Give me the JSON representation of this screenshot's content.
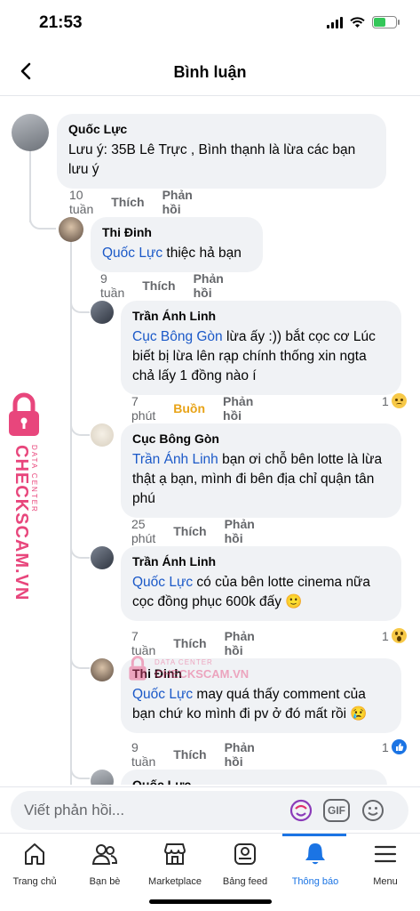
{
  "status_bar": {
    "time": "21:53"
  },
  "header": {
    "title": "Bình luận"
  },
  "comments": [
    {
      "author": "Quốc Lực",
      "mention": "",
      "text": "Lưu ý: 35B Lê Trực , Bình thạnh là lừa các bạn lưu ý",
      "time": "10 tuần",
      "like": "Thích",
      "reply": "Phản hồi"
    },
    {
      "author": "Thi Đinh",
      "mention": "Quốc Lực",
      "text": "thiệc hả bạn",
      "time": "9 tuần",
      "like": "Thích",
      "reply": "Phản hồi"
    },
    {
      "author": "Trần Ánh Linh",
      "mention": "Cục Bông Gòn",
      "text": "lừa ấy :)) bắt cọc cơ Lúc biết bị lừa lên rạp chính thống xin ngta chả lấy 1 đồng nào í",
      "time": "7 phút",
      "like": "Buồn",
      "reply": "Phản hồi",
      "reaction_count": "1",
      "reaction": "sad-emoji"
    },
    {
      "author": "Cục Bông Gòn",
      "mention": "Trần Ánh Linh",
      "text": "bạn ơi chỗ bên lotte là lừa thật ạ bạn, mình đi bên địa chỉ quận tân phú",
      "time": "25 phút",
      "like": "Thích",
      "reply": "Phản hồi"
    },
    {
      "author": "Trần Ánh Linh",
      "mention": "Quốc Lực",
      "text": "có của bên lotte cinema nữa cọc đồng phục 600k đấy 🙂",
      "time": "7 tuần",
      "like": "Thích",
      "reply": "Phản hồi",
      "reaction_count": "1",
      "reaction": "wow-emoji"
    },
    {
      "author": "Thi Đinh",
      "mention": "Quốc Lực",
      "text": "may quá thấy comment của bạn chứ ko mình đi pv ở đó mất rồi 😢",
      "time": "9 tuần",
      "like": "Thích",
      "reply": "Phản hồi",
      "reaction_count": "1",
      "reaction": "like-emoji"
    },
    {
      "author": "Quốc Lực",
      "mention": "",
      "text": "",
      "time": "",
      "like": "",
      "reply": ""
    }
  ],
  "composer": {
    "placeholder": "Viết phản hồi...",
    "gif_label": "GIF"
  },
  "tabs": [
    {
      "label": "Trang chủ",
      "icon": "home-icon"
    },
    {
      "label": "Bạn bè",
      "icon": "friends-icon"
    },
    {
      "label": "Marketplace",
      "icon": "marketplace-icon"
    },
    {
      "label": "Bảng feed",
      "icon": "feed-icon"
    },
    {
      "label": "Thông báo",
      "icon": "bell-icon",
      "active": true
    },
    {
      "label": "Menu",
      "icon": "menu-icon"
    }
  ],
  "watermark": {
    "brand": "CHECKSCAM.VN",
    "sub": "DATA CENTER"
  },
  "colors": {
    "accent": "#1b74e4",
    "mention": "#1b59c8",
    "bubble": "#f0f2f5",
    "watermark": "#e8467c",
    "sad": "#e8a317"
  }
}
